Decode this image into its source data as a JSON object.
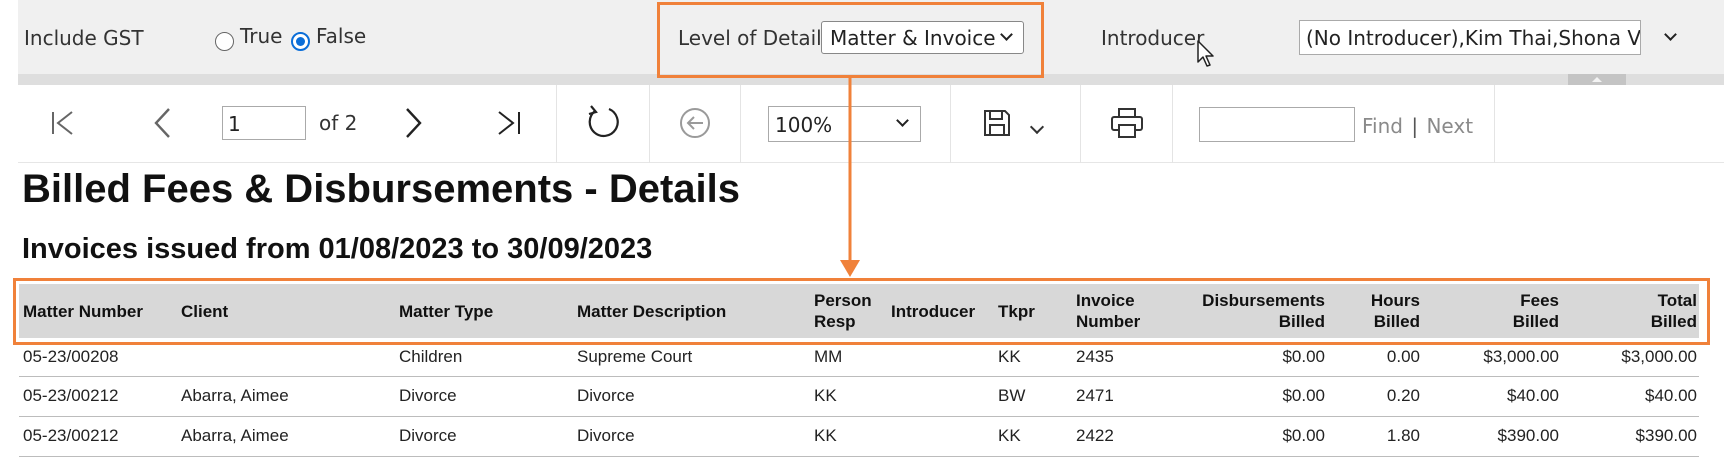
{
  "params": {
    "include_gst_label": "Include GST",
    "radio_true_label": "True",
    "radio_false_label": "False",
    "radio_selected": "False",
    "level_of_detail_label": "Level of Detail",
    "level_of_detail_value": "Matter & Invoice",
    "introducer_label": "Introducer",
    "introducer_value": "(No Introducer),Kim Thai,Shona  Vi"
  },
  "toolbar": {
    "page_number": "1",
    "of_pages": "of 2",
    "zoom_value": "100%",
    "find_value": "",
    "find_label": "Find",
    "find_separator": "|",
    "next_label": "Next"
  },
  "report": {
    "title": "Billed Fees & Disbursements - Details",
    "subtitle": "Invoices issued from 01/08/2023 to 30/09/2023",
    "columns": {
      "matter_number": "Matter Number",
      "client": "Client",
      "matter_type": "Matter Type",
      "matter_description": "Matter Description",
      "person_resp_1": "Person",
      "person_resp_2": "Resp",
      "introducer": "Introducer",
      "tkpr": "Tkpr",
      "invoice_number_1": "Invoice",
      "invoice_number_2": "Number",
      "disbursements_billed_1": "Disbursements",
      "disbursements_billed_2": "Billed",
      "hours_billed_1": "Hours",
      "hours_billed_2": "Billed",
      "fees_billed_1": "Fees",
      "fees_billed_2": "Billed",
      "total_billed_1": "Total",
      "total_billed_2": "Billed"
    },
    "rows": [
      {
        "matter_number": "05-23/00208",
        "client": "",
        "matter_type": "Children",
        "matter_description": "Supreme Court",
        "person_resp": "MM",
        "introducer": "",
        "tkpr": "KK",
        "invoice_number": "2435",
        "disbursements_billed": "$0.00",
        "hours_billed": "0.00",
        "fees_billed": "$3,000.00",
        "total_billed": "$3,000.00"
      },
      {
        "matter_number": "05-23/00212",
        "client": "Abarra, Aimee",
        "matter_type": "Divorce",
        "matter_description": "Divorce",
        "person_resp": "KK",
        "introducer": "",
        "tkpr": "BW",
        "invoice_number": "2471",
        "disbursements_billed": "$0.00",
        "hours_billed": "0.20",
        "fees_billed": "$40.00",
        "total_billed": "$40.00"
      },
      {
        "matter_number": "05-23/00212",
        "client": "Abarra, Aimee",
        "matter_type": "Divorce",
        "matter_description": "Divorce",
        "person_resp": "KK",
        "introducer": "",
        "tkpr": "KK",
        "invoice_number": "2422",
        "disbursements_billed": "$0.00",
        "hours_billed": "1.80",
        "fees_billed": "$390.00",
        "total_billed": "$390.00"
      }
    ]
  },
  "colors": {
    "highlight": "#f0813a",
    "radio_accent": "#0b6ed8",
    "header_bg": "#d8d8d8",
    "param_bg": "#f0f0f0"
  },
  "icons": [
    "first-page-icon",
    "previous-page-icon",
    "next-page-icon",
    "last-page-icon",
    "refresh-icon",
    "back-icon",
    "save-icon",
    "chevron-down-icon",
    "print-icon",
    "mouse-cursor-icon",
    "collapse-arrow-icon"
  ]
}
